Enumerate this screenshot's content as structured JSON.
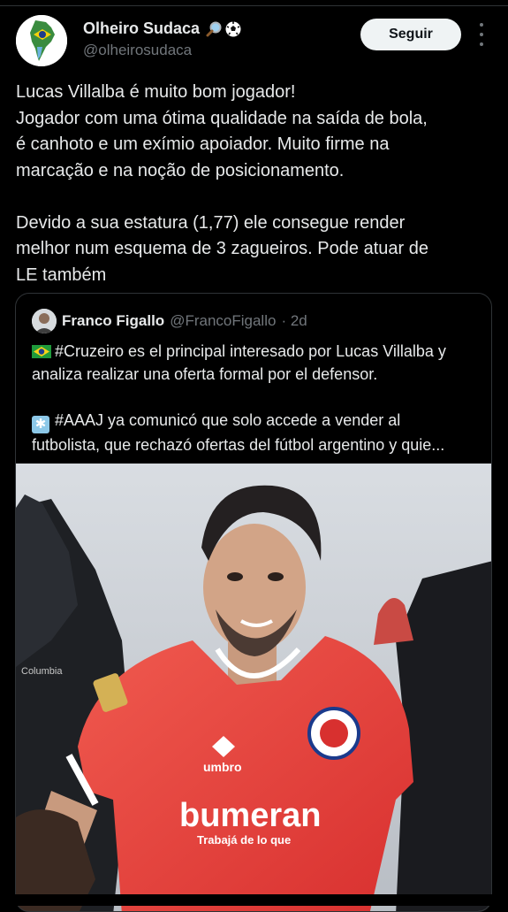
{
  "author": {
    "display_name": "Olheiro Sudaca",
    "handle": "@olheirosudaca",
    "badges": [
      "magnifier-icon",
      "soccer-ball-icon"
    ]
  },
  "follow_label": "Seguir",
  "tweet": {
    "lines_para1": [
      "Lucas Villalba é muito bom jogador!",
      "Jogador com uma ótima qualidade na saída de bola,",
      "é canhoto e um exímio apoiador. Muito firme na",
      "marcação e na noção de posicionamento."
    ],
    "lines_para2": [
      "Devido a sua estatura (1,77) ele consegue render",
      "melhor num esquema de 3 zagueiros. Pode atuar de",
      "LE também"
    ]
  },
  "quote": {
    "name": "Franco Figallo",
    "handle": "@FrancoFigallo",
    "time": "· 2d",
    "para1": [
      "#Cruzeiro es el principal interesado por Lucas Villalba y",
      "analiza realizar una oferta formal por el defensor."
    ],
    "para2": [
      "#AAAJ ya comunicó que solo accede a vender al",
      "futbolista, que rechazó ofertas del fútbol argentino y quie..."
    ],
    "photo_text": {
      "sponsor": "bumeran",
      "slogan": "Trabajá de lo que",
      "kit_brand": "umbro",
      "jacket_brand": "Columbia"
    }
  },
  "colors": {
    "background": "#000000",
    "text": "#e7e9ea",
    "muted": "#71767b",
    "border": "#2f3336",
    "jersey_red": "#e8403f"
  }
}
